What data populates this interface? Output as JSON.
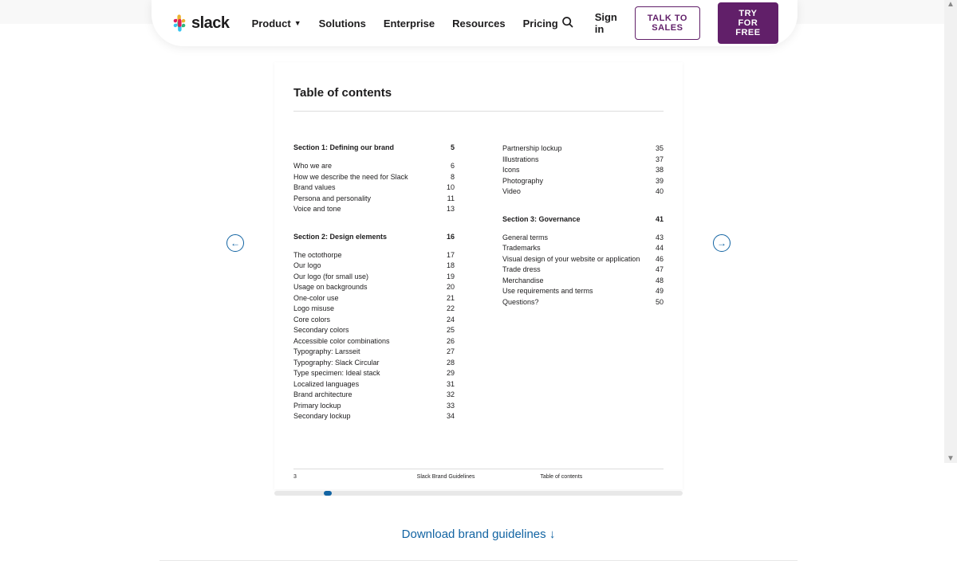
{
  "nav": {
    "brand": "slack",
    "links": {
      "product": "Product",
      "solutions": "Solutions",
      "enterprise": "Enterprise",
      "resources": "Resources",
      "pricing": "Pricing"
    },
    "signin": "Sign in",
    "talk_to_sales": "TALK TO SALES",
    "try_for_free": "TRY FOR FREE"
  },
  "doc": {
    "title": "Table of contents",
    "section1": {
      "label": "Section 1: Defining our brand",
      "page": "5"
    },
    "s1_items": [
      {
        "label": "Who we are",
        "page": "6"
      },
      {
        "label": "How we describe the need for Slack",
        "page": "8"
      },
      {
        "label": "Brand values",
        "page": "10"
      },
      {
        "label": "Persona and personality",
        "page": "11"
      },
      {
        "label": "Voice and tone",
        "page": "13"
      }
    ],
    "section2": {
      "label": "Section 2: Design elements",
      "page": "16"
    },
    "s2_items": [
      {
        "label": "The octothorpe",
        "page": "17"
      },
      {
        "label": "Our logo",
        "page": "18"
      },
      {
        "label": "Our logo (for small use)",
        "page": "19"
      },
      {
        "label": "Usage on backgrounds",
        "page": "20"
      },
      {
        "label": "One-color use",
        "page": "21"
      },
      {
        "label": "Logo misuse",
        "page": "22"
      },
      {
        "label": "Core colors",
        "page": "24"
      },
      {
        "label": "Secondary colors",
        "page": "25"
      },
      {
        "label": "Accessible color combinations",
        "page": "26"
      },
      {
        "label": "Typography: Larsseit",
        "page": "27"
      },
      {
        "label": "Typography: Slack Circular",
        "page": "28"
      },
      {
        "label": "Type specimen: Ideal stack",
        "page": "29"
      },
      {
        "label": "Localized languages",
        "page": "31"
      },
      {
        "label": "Brand architecture",
        "page": "32"
      },
      {
        "label": "Primary lockup",
        "page": "33"
      },
      {
        "label": "Secondary lockup",
        "page": "34"
      }
    ],
    "right_top": [
      {
        "label": "Partnership lockup",
        "page": "35"
      },
      {
        "label": "Illustrations",
        "page": "37"
      },
      {
        "label": "Icons",
        "page": "38"
      },
      {
        "label": "Photography",
        "page": "39"
      },
      {
        "label": "Video",
        "page": "40"
      }
    ],
    "section3": {
      "label": "Section 3: Governance",
      "page": "41"
    },
    "s3_items": [
      {
        "label": "General terms",
        "page": "43"
      },
      {
        "label": "Trademarks",
        "page": "44"
      },
      {
        "label": "Visual design of your website or application",
        "page": "46"
      },
      {
        "label": "Trade dress",
        "page": "47"
      },
      {
        "label": "Merchandise",
        "page": "48"
      },
      {
        "label": "Use requirements and terms",
        "page": "49"
      },
      {
        "label": "Questions?",
        "page": "50"
      }
    ],
    "footer": {
      "pagenum": "3",
      "center": "Slack Brand Guidelines",
      "right": "Table of contents"
    }
  },
  "download": "Download brand guidelines"
}
